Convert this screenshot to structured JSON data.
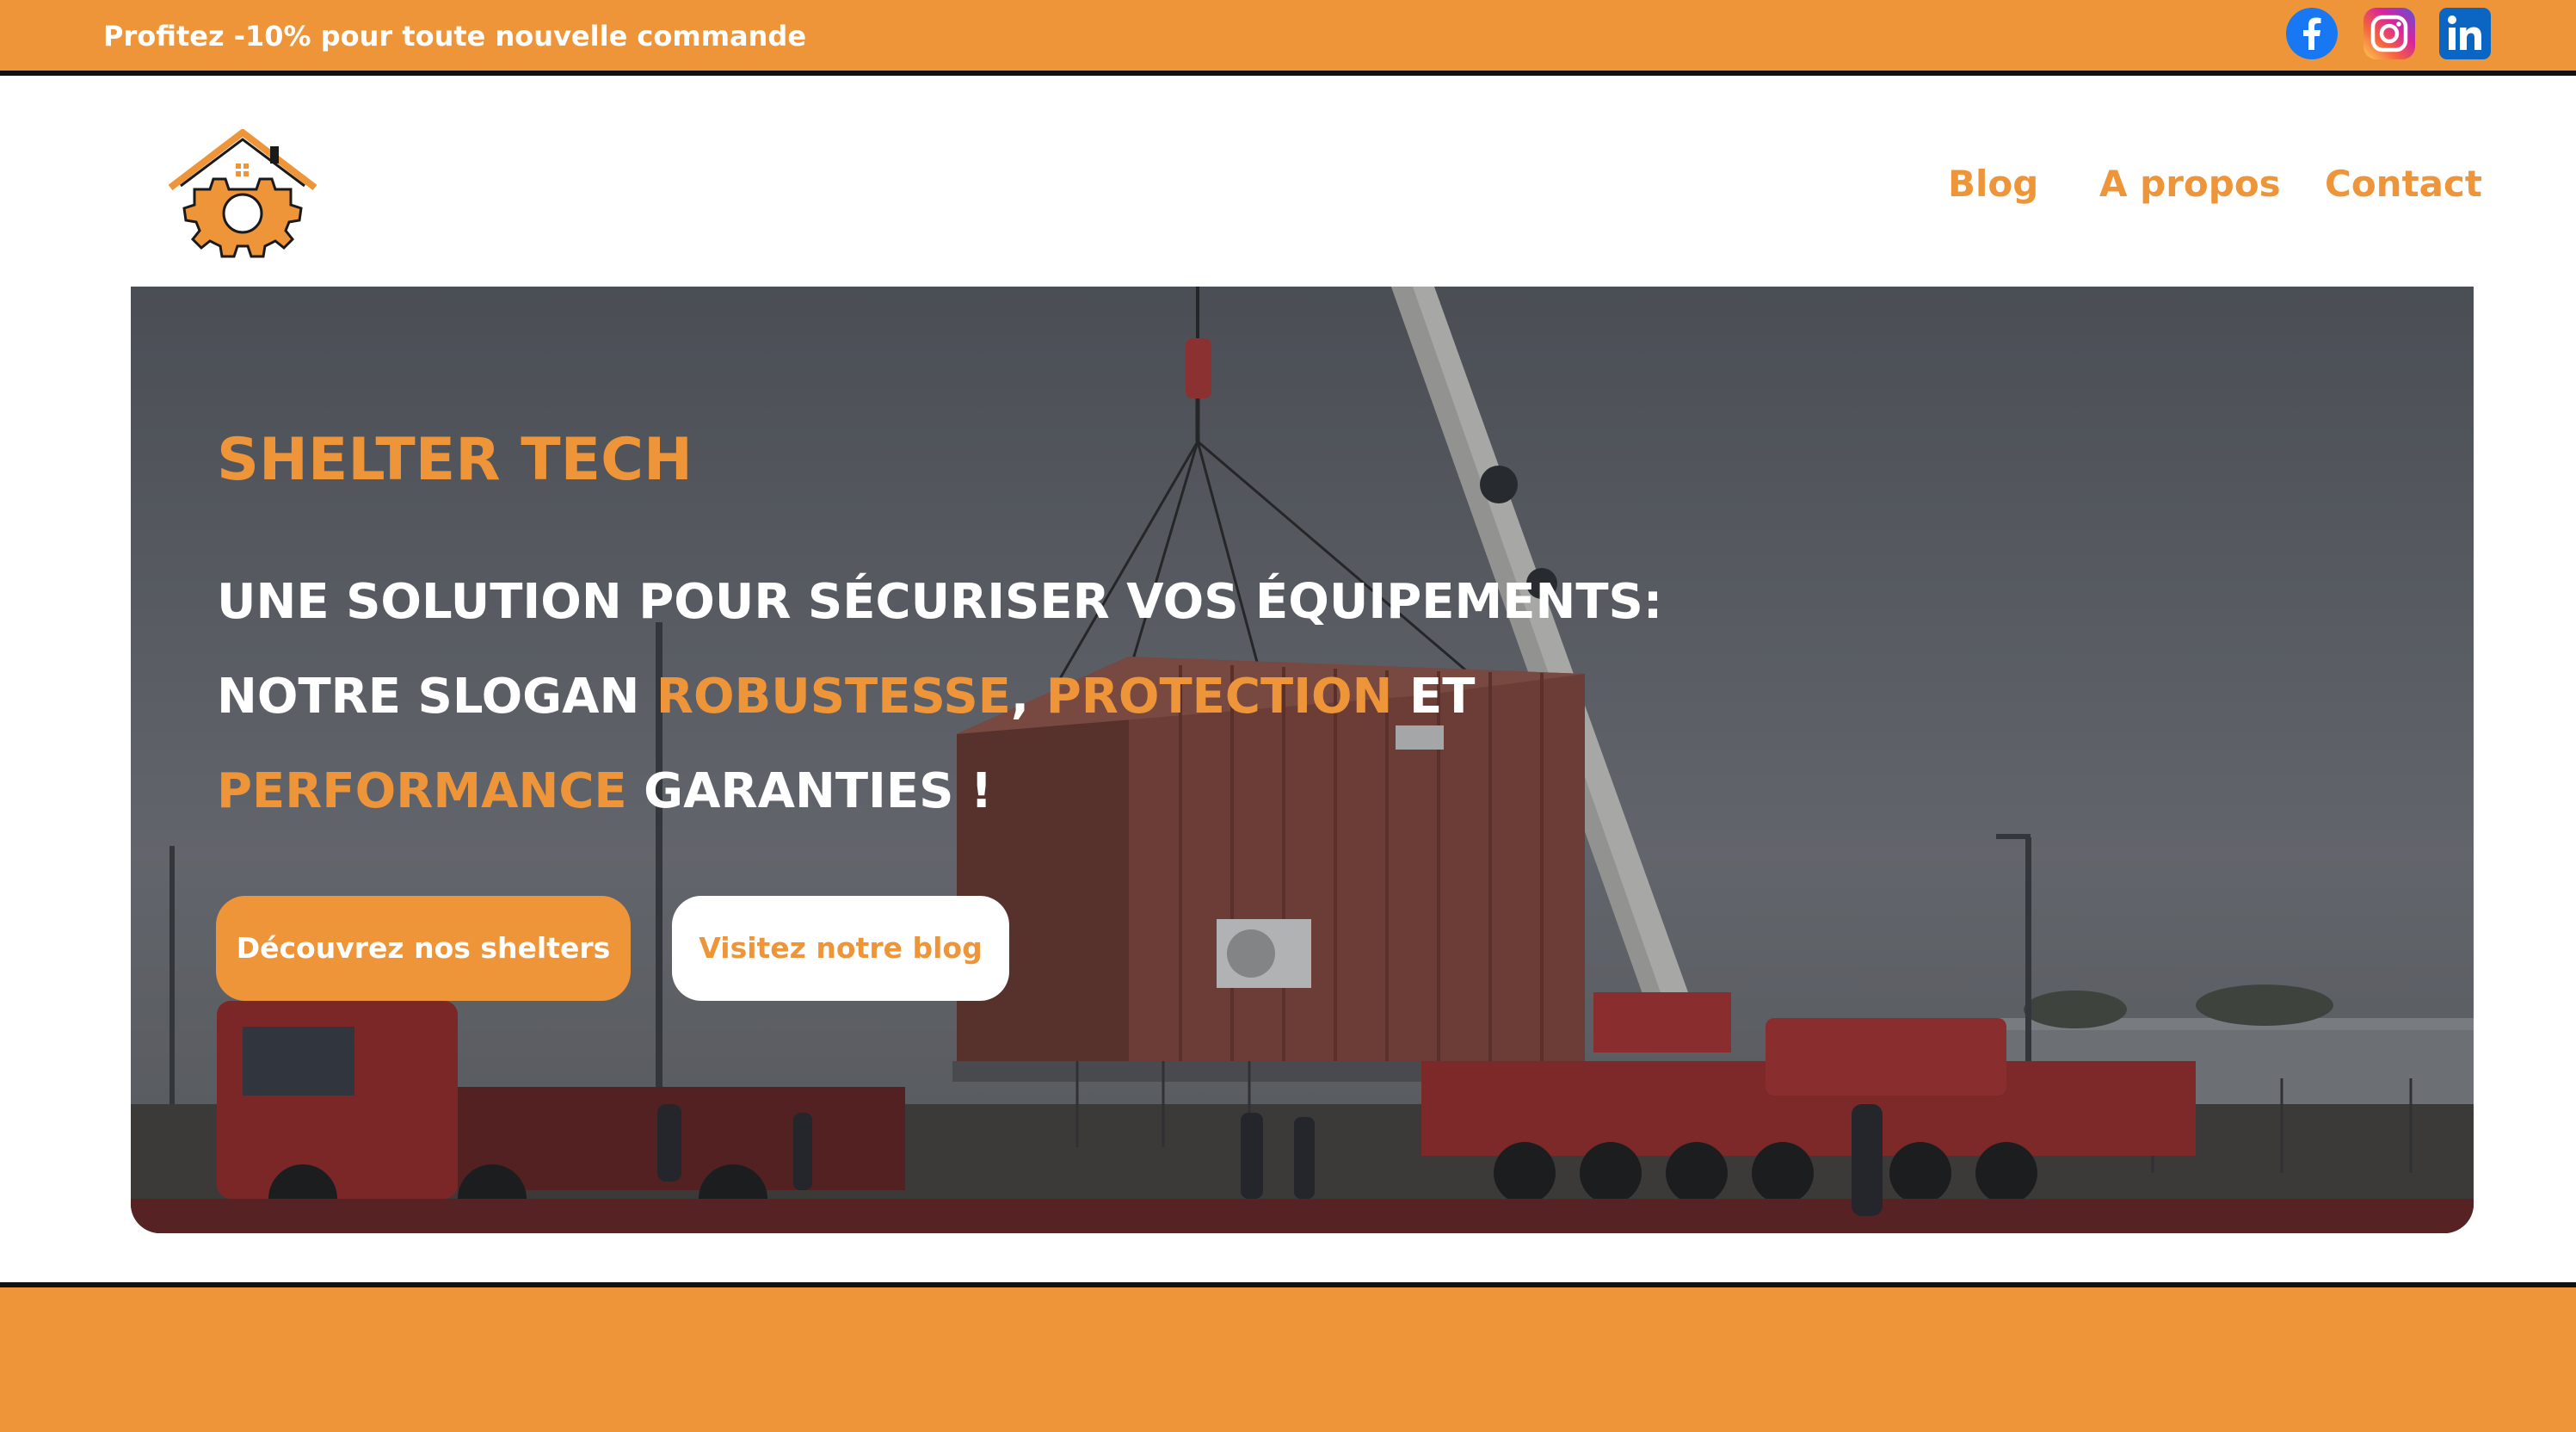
{
  "topbar": {
    "promo_text": "Profitez -10% pour toute nouvelle commande",
    "social": [
      {
        "icon": "facebook-icon",
        "color": "#1877f2"
      },
      {
        "icon": "instagram-icon",
        "color": "#d6249f"
      },
      {
        "icon": "linkedin-icon",
        "color": "#0a66c2"
      }
    ]
  },
  "header": {
    "logo": "house-gear-logo-icon",
    "nav": {
      "blog": "Blog",
      "about": "A propos",
      "contact": "Contact"
    }
  },
  "hero": {
    "title": "SHELTER TECH",
    "line1": "UNE SOLUTION POUR SÉCURISER VOS ÉQUIPEMENTS:",
    "line2": {
      "part1": "NOTRE SLOGAN ",
      "accent1": "ROBUSTESSE",
      "sep": ", ",
      "accent2": "PROTECTION",
      "part2": " ET"
    },
    "line3": {
      "accent": "PERFORMANCE",
      "part": " GARANTIES !"
    },
    "buttons": {
      "primary": "Découvrez nos shelters",
      "secondary": "Visitez notre blog"
    }
  },
  "colors": {
    "accent": "#ee9539",
    "border": "#111111",
    "white": "#ffffff"
  }
}
